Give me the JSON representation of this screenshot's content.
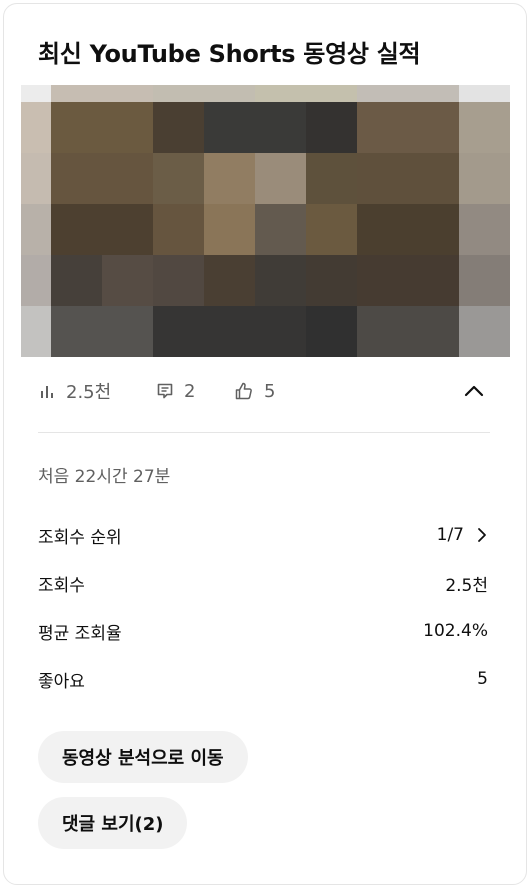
{
  "card": {
    "title": "최신 YouTube Shorts 동영상 실적"
  },
  "stats": {
    "views": "2.5천",
    "comments": "2",
    "likes": "5"
  },
  "details": {
    "first_period": "처음 22시간 27분",
    "rows": [
      {
        "label": "조회수 순위",
        "value": "1/7"
      },
      {
        "label": "조회수",
        "value": "2.5천"
      },
      {
        "label": "평균 조회율",
        "value": "102.4%"
      },
      {
        "label": "좋아요",
        "value": "5"
      }
    ]
  },
  "buttons": {
    "analytics": "동영상 분석으로 이동",
    "comments": "댓글 보기(2)"
  },
  "thumbnail_colors": [
    [
      "#ececec",
      "#c6bdb2",
      "#c6bdb2",
      "#c2bdb1",
      "#c2bdb1",
      "#c4c0ad",
      "#c4c0ad",
      "#c2bdb6",
      "#c2bdb6",
      "#e3e3e3"
    ],
    [
      "#c9beb1",
      "#6b5a40",
      "#6b5a40",
      "#4a3f32",
      "#3a3a38",
      "#3a3a38",
      "#343230",
      "#6b5a46",
      "#6b5a46",
      "#a79e8f"
    ],
    [
      "#c5bbb0",
      "#66553f",
      "#66553f",
      "#6b5d47",
      "#917d62",
      "#9a8c7a",
      "#5e513c",
      "#5f503c",
      "#5f503c",
      "#a39a8c"
    ],
    [
      "#b8b1a9",
      "#4d4030",
      "#4d4030",
      "#66553f",
      "#8a7558",
      "#635a4f",
      "#6b5a40",
      "#4b3f2f",
      "#4b3f2f",
      "#928a82"
    ],
    [
      "#b2aca8",
      "#46403a",
      "#564c44",
      "#514841",
      "#4a3f33",
      "#403c37",
      "#433b33",
      "#463b31",
      "#463b31",
      "#847d77"
    ],
    [
      "#c3c2c0",
      "#555350",
      "#555350",
      "#363534",
      "#363534",
      "#363534",
      "#303030",
      "#4d4a46",
      "#4d4a46",
      "#9a9896"
    ]
  ]
}
